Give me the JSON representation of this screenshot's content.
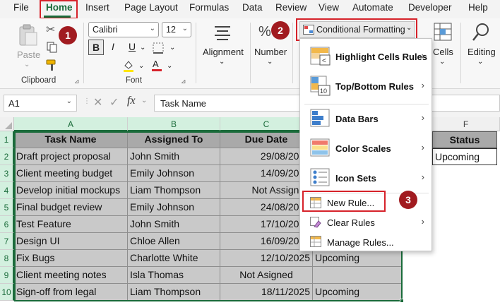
{
  "menu_tabs": [
    "File",
    "Home",
    "Insert",
    "Page Layout",
    "Formulas",
    "Data",
    "Review",
    "View",
    "Automate",
    "Developer",
    "Help"
  ],
  "ribbon": {
    "clipboard": {
      "paste_label": "Paste",
      "group_label": "Clipboard"
    },
    "font": {
      "name": "Calibri",
      "size": "12",
      "bold": "B",
      "italic": "I",
      "underline": "U",
      "group_label": "Font"
    },
    "alignment_label": "Alignment",
    "number_label": "Number",
    "conditional_formatting_label": "Conditional Formatting",
    "cells_label": "Cells",
    "editing_label": "Editing"
  },
  "formula_bar": {
    "name_box": "A1",
    "fx": "fx",
    "content": "Task Name"
  },
  "sheet": {
    "columns": [
      "A",
      "B",
      "C",
      "D",
      "E",
      "F"
    ],
    "rows": [
      "1",
      "2",
      "3",
      "4",
      "5",
      "6",
      "7",
      "8",
      "9",
      "10"
    ],
    "headers": [
      "Task Name",
      "Assigned To",
      "Due Date"
    ],
    "status_header": "Status",
    "status_values": [
      "Upcoming"
    ],
    "data": [
      [
        "Draft project proposal",
        "John Smith",
        "29/08/2025"
      ],
      [
        "Client meeting budget",
        "Emily Johnson",
        "14/09/2025"
      ],
      [
        "Develop initial mockups",
        "Liam Thompson",
        "Not Assigned"
      ],
      [
        "Final budget review",
        "Emily Johnson",
        "24/08/2025"
      ],
      [
        "Test Feature",
        "John Smith",
        "17/10/2025"
      ],
      [
        "Design UI",
        "Chloe Allen",
        "16/09/2025"
      ],
      [
        "Fix Bugs",
        "Charlotte White",
        "12/10/2025"
      ],
      [
        "Client meeting notes",
        "Isla Thomas",
        "Not Asigned"
      ],
      [
        "Sign-off from legal",
        "Liam Thompson",
        "18/11/2025"
      ]
    ],
    "col_d_visible": [
      "",
      "",
      "",
      "",
      "",
      "",
      "Upcoming",
      "",
      "Upcoming"
    ]
  },
  "cf_menu": {
    "items": [
      "Highlight Cells Rules",
      "Top/Bottom Rules",
      "Data Bars",
      "Color Scales",
      "Icon Sets",
      "New Rule...",
      "Clear Rules",
      "Manage Rules..."
    ]
  },
  "callouts": [
    "1",
    "2",
    "3"
  ],
  "colors": {
    "excel_green": "#1a6b3a",
    "callout_red": "#a11b20",
    "highlight_red": "#d6222a",
    "cell_gray": "#c9c9c9",
    "header_gray": "#a9a9a9"
  }
}
